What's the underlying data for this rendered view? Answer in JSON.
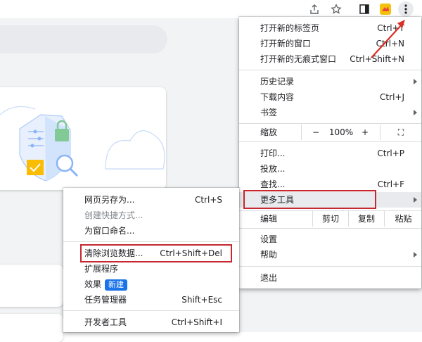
{
  "main_menu": {
    "items": [
      {
        "label": "打开新的标签页",
        "shortcut": "Ctrl+T"
      },
      {
        "label": "打开新的窗口",
        "shortcut": "Ctrl+N"
      },
      {
        "label": "打开新的无痕式窗口",
        "shortcut": "Ctrl+Shift+N"
      },
      {
        "label": "历史记录"
      },
      {
        "label": "下载内容",
        "shortcut": "Ctrl+J"
      },
      {
        "label": "书签"
      },
      {
        "label": "打印...",
        "shortcut": "Ctrl+P"
      },
      {
        "label": "投放..."
      },
      {
        "label": "查找...",
        "shortcut": "Ctrl+F"
      },
      {
        "label": "更多工具"
      },
      {
        "label": "设置"
      },
      {
        "label": "帮助"
      },
      {
        "label": "退出"
      }
    ],
    "zoom": {
      "label": "缩放",
      "minus": "−",
      "value": "100%",
      "plus": "+",
      "fullscreen": "⛶"
    },
    "edit": {
      "label": "编辑",
      "cut": "剪切",
      "copy": "复制",
      "paste": "粘贴"
    }
  },
  "submenu": {
    "items": [
      {
        "label": "网页另存为...",
        "shortcut": "Ctrl+S"
      },
      {
        "label": "创建快捷方式..."
      },
      {
        "label": "为窗口命名..."
      },
      {
        "label": "清除浏览数据...",
        "shortcut": "Ctrl+Shift+Del"
      },
      {
        "label": "扩展程序"
      },
      {
        "label": "效果",
        "badge": "新建"
      },
      {
        "label": "任务管理器",
        "shortcut": "Shift+Esc"
      },
      {
        "label": "开发者工具",
        "shortcut": "Ctrl+Shift+I"
      }
    ]
  },
  "colors": {
    "highlight": "#c5282f",
    "accent": "#1a73e8",
    "arrow": "#d93025"
  }
}
